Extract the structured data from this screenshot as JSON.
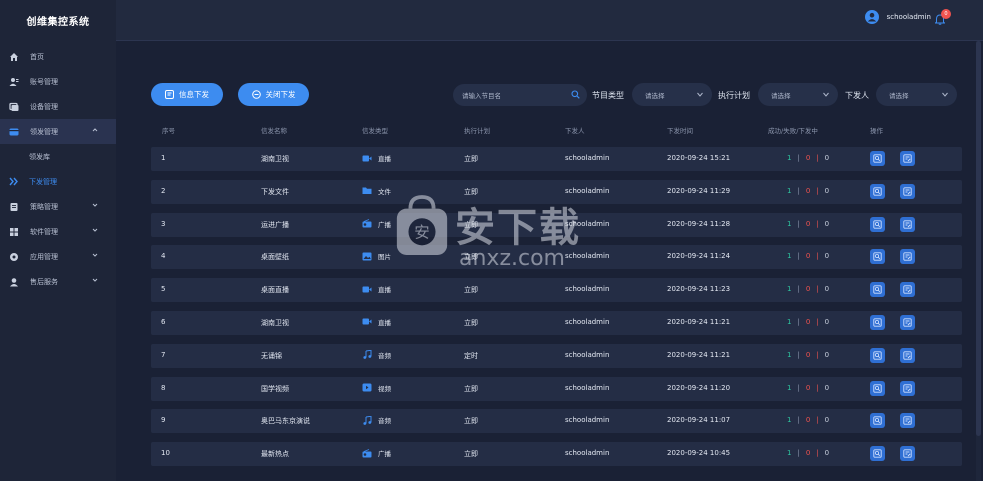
{
  "app": {
    "title": "创维集控系统"
  },
  "sidebar": {
    "items": [
      {
        "label": "首页",
        "icon": "home-icon"
      },
      {
        "label": "账号管理",
        "icon": "user-icon"
      },
      {
        "label": "设备管理",
        "icon": "device-icon"
      },
      {
        "label": "领发管理",
        "icon": "send-icon",
        "expanded": true,
        "children": [
          {
            "label": "领发库"
          },
          {
            "label": "下发管理",
            "current": true
          }
        ]
      },
      {
        "label": "策略管理",
        "icon": "strategy-icon"
      },
      {
        "label": "软件管理",
        "icon": "software-icon"
      },
      {
        "label": "应用管理",
        "icon": "app-icon"
      },
      {
        "label": "售后服务",
        "icon": "service-icon"
      }
    ]
  },
  "header": {
    "username": "schooladmin",
    "notification_count": "0"
  },
  "toolbar": {
    "issue_btn": "信息下发",
    "close_btn": "关闭下发",
    "search_placeholder": "请输入节目名",
    "program_type_label": "节目类型",
    "program_type_value": "请选择",
    "plan_label": "执行计划",
    "plan_value": "请选择",
    "issuer_label": "下发人",
    "issuer_value": "请选择"
  },
  "table": {
    "headers": [
      "序号",
      "信发名称",
      "信发类型",
      "执行计划",
      "下发人",
      "下发时间",
      "成功/失败/下发中",
      "操作"
    ],
    "rows": [
      {
        "no": "1",
        "name": "湖南卫视",
        "type": "直播",
        "type_icon": "video-icon",
        "plan": "立即",
        "issuer": "schooladmin",
        "time": "2020-09-24 15:21",
        "ok": "1",
        "fail": "0",
        "pending": "0"
      },
      {
        "no": "2",
        "name": "下发文件",
        "type": "文件",
        "type_icon": "folder-icon",
        "plan": "立即",
        "issuer": "schooladmin",
        "time": "2020-09-24 11:29",
        "ok": "1",
        "fail": "0",
        "pending": "0"
      },
      {
        "no": "3",
        "name": "运进广播",
        "type": "广播",
        "type_icon": "radio-icon",
        "plan": "立即",
        "issuer": "schooladmin",
        "time": "2020-09-24 11:28",
        "ok": "1",
        "fail": "0",
        "pending": "0"
      },
      {
        "no": "4",
        "name": "桌面壁纸",
        "type": "图片",
        "type_icon": "image-icon",
        "plan": "立即",
        "issuer": "schooladmin",
        "time": "2020-09-24 11:24",
        "ok": "1",
        "fail": "0",
        "pending": "0"
      },
      {
        "no": "5",
        "name": "桌面直播",
        "type": "直播",
        "type_icon": "video-icon",
        "plan": "立即",
        "issuer": "schooladmin",
        "time": "2020-09-24 11:23",
        "ok": "1",
        "fail": "0",
        "pending": "0"
      },
      {
        "no": "6",
        "name": "湖南卫视",
        "type": "直播",
        "type_icon": "video-icon",
        "plan": "立即",
        "issuer": "schooladmin",
        "time": "2020-09-24 11:21",
        "ok": "1",
        "fail": "0",
        "pending": "0"
      },
      {
        "no": "7",
        "name": "无诵锦",
        "type": "音频",
        "type_icon": "music-icon",
        "plan": "定时",
        "issuer": "schooladmin",
        "time": "2020-09-24 11:21",
        "ok": "1",
        "fail": "0",
        "pending": "0"
      },
      {
        "no": "8",
        "name": "国学视频",
        "type": "视频",
        "type_icon": "play-icon",
        "plan": "立即",
        "issuer": "schooladmin",
        "time": "2020-09-24 11:20",
        "ok": "1",
        "fail": "0",
        "pending": "0"
      },
      {
        "no": "9",
        "name": "奥巴马东京演说",
        "type": "音频",
        "type_icon": "music-icon",
        "plan": "立即",
        "issuer": "schooladmin",
        "time": "2020-09-24 11:07",
        "ok": "1",
        "fail": "0",
        "pending": "0"
      },
      {
        "no": "10",
        "name": "最新热点",
        "type": "广播",
        "type_icon": "radio-icon",
        "plan": "立即",
        "issuer": "schooladmin",
        "time": "2020-09-24 10:45",
        "ok": "1",
        "fail": "0",
        "pending": "0"
      }
    ]
  },
  "watermark": {
    "brand": "安下载",
    "url": "anxz.com"
  },
  "colors": {
    "accent": "#3d8cf0",
    "success": "#2ec7a0",
    "danger": "#f0534f",
    "background": "#1b2236"
  }
}
